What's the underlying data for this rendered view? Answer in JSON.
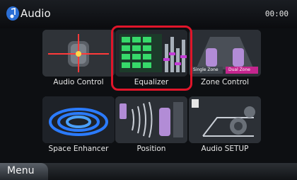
{
  "header": {
    "title": "Audio",
    "clock": "00:00",
    "icon": "music-note-icon"
  },
  "tiles": [
    {
      "label": "Audio Control",
      "icon": "audio-control-icon"
    },
    {
      "label": "Equalizer",
      "icon": "equalizer-icon",
      "selected": true
    },
    {
      "label": "Zone Control",
      "icon": "zone-control-icon",
      "zone_badges": [
        "Single Zone",
        "Dual Zone"
      ]
    },
    {
      "label": "Space Enhancer",
      "icon": "space-enhancer-icon"
    },
    {
      "label": "Position",
      "icon": "position-icon"
    },
    {
      "label": "Audio SETUP",
      "icon": "audio-setup-icon"
    }
  ],
  "footer": {
    "menu_label": "Menu"
  },
  "colors": {
    "selection": "#e0152a",
    "accent_blue": "#2b7bff"
  }
}
